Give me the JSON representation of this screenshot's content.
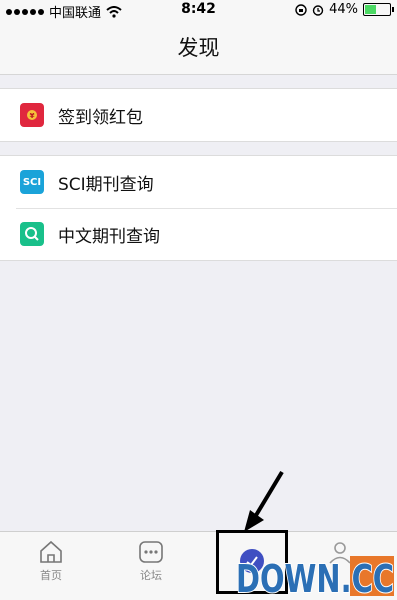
{
  "status": {
    "carrier": "中国联通",
    "time": "8:42",
    "battery": "44%"
  },
  "nav": {
    "title": "发现"
  },
  "groups": [
    {
      "items": [
        {
          "label": "签到领红包",
          "icon": "red-packet-icon"
        }
      ]
    },
    {
      "items": [
        {
          "label": "SCI期刊查询",
          "icon": "sci-icon",
          "icon_text": "SCI"
        },
        {
          "label": "中文期刊查询",
          "icon": "search-icon"
        }
      ]
    }
  ],
  "tabs": [
    {
      "label": "首页",
      "icon": "home-icon"
    },
    {
      "label": "论坛",
      "icon": "chat-icon"
    },
    {
      "label": "",
      "icon": "discover-icon"
    },
    {
      "label": "",
      "icon": "profile-icon"
    }
  ],
  "watermark": {
    "text": "DOWN.CC"
  },
  "colors": {
    "red_icon": "#e0273e",
    "sci_icon": "#1aa3d9",
    "search_icon": "#19c08a",
    "accent": "#3f4fc2"
  }
}
